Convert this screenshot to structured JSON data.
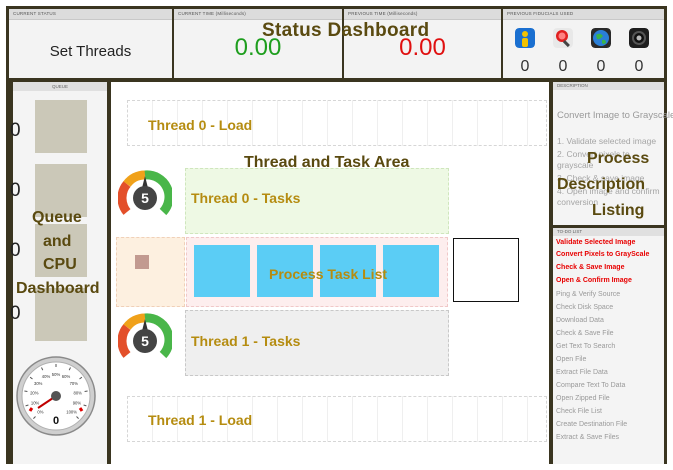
{
  "status": {
    "headers": {
      "current_status": "CURRENT STATUS",
      "current_time": "CURRENT TIME (Milliseconds)",
      "previous_time": "PREVIOUS TIME (Milliseconds)",
      "previous_fiducials": "PREVIOUS FIDUCIALS USED"
    },
    "set_threads_label": "Set Threads",
    "current_time_value": "0.00",
    "previous_time_value": "0.00",
    "fiducial_counts": [
      "0",
      "0",
      "0",
      "0"
    ],
    "fiducial_icons": [
      "person-icon",
      "magnifier-icon",
      "globe-icon",
      "camera-icon"
    ]
  },
  "overlays": {
    "status_dashboard": "Status Dashboard",
    "thread_task_area": "Thread and Task Area",
    "queue_cpu": [
      "Queue",
      "and",
      "CPU",
      "Dashboard"
    ],
    "process_description": [
      "Process",
      "Description",
      "Listing"
    ]
  },
  "queue": {
    "header": "QUEUE",
    "counts": [
      "0",
      "0",
      "0",
      "0"
    ]
  },
  "cpu_speedometer": {
    "value": "0",
    "scale_labels": [
      "0%",
      "10%",
      "20%",
      "30%",
      "40%",
      "50%",
      "60%",
      "70%",
      "80%",
      "90%",
      "100%"
    ]
  },
  "threads": {
    "thread0_load": "Thread 0 - Load",
    "thread0_tasks": "Thread 0 - Tasks",
    "thread1_tasks": "Thread 1 - Tasks",
    "thread1_load": "Thread 1 - Load",
    "thread0_gauge_value": "5",
    "thread1_gauge_value": "5",
    "process_task_list": "Process Task List"
  },
  "description": {
    "header": "DESCRIPTION",
    "title": "Convert Image to Grayscale:",
    "steps": [
      "1. Validate selected image",
      "2. Convert pixels to grayscale",
      "3. Check & save image",
      "4. Open image and confirm conversion"
    ]
  },
  "todo": {
    "header": "TO-DO LIST",
    "active_items": [
      "Validate Selected Image",
      "Convert Pixels to GrayScale",
      "Check & Save Image",
      "Open & Confirm Image"
    ],
    "items": [
      "Ping & Verify Source",
      "Check Disk Space",
      "Download Data",
      "Check & Save File",
      "Get Text To Search",
      "Open File",
      "Extract File Data",
      "Compare Text To Data",
      "Open Zipped File",
      "Check File List",
      "Create Destination File",
      "Extract & Save Files"
    ]
  },
  "colors": {
    "frame": "#3a3520",
    "overlay_text": "#5a4a10",
    "lane_label": "#b58c10",
    "task_blue": "#5bcdf5",
    "todo_active": "#e80000",
    "value_green": "#1e9e1e",
    "value_red": "#e01010"
  }
}
